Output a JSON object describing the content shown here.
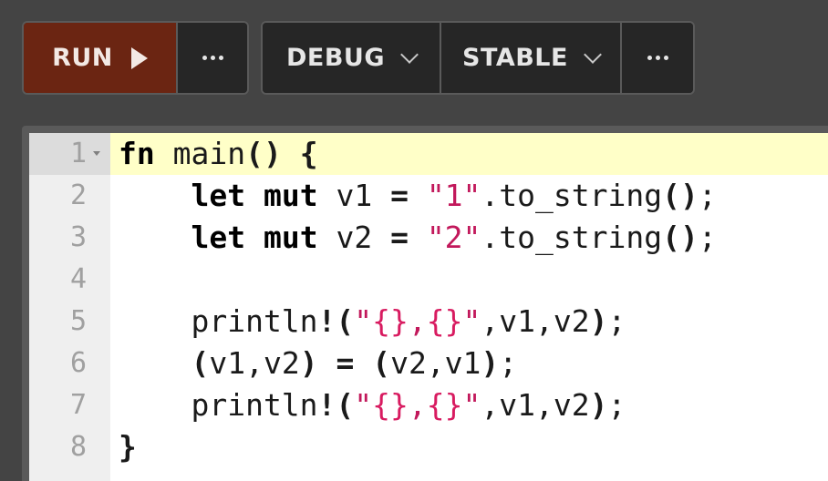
{
  "toolbar": {
    "run_label": "RUN",
    "run_icon": "play-icon",
    "more_icon": "ellipsis-icon",
    "debug_label": "DEBUG",
    "stable_label": "STABLE",
    "dropdown_icon": "chevron-down-icon",
    "colors": {
      "run_bg": "#6b2512",
      "button_bg": "#262626",
      "page_bg": "#444444"
    }
  },
  "editor": {
    "active_line": 1,
    "active_line_color": "#ffffc8",
    "lines": [
      {
        "number": "1",
        "text": "fn main() {"
      },
      {
        "number": "2",
        "text": "    let mut v1 = \"1\".to_string();"
      },
      {
        "number": "3",
        "text": "    let mut v2 = \"2\".to_string();"
      },
      {
        "number": "4",
        "text": ""
      },
      {
        "number": "5",
        "text": "    println!(\"{},{}\",v1,v2);"
      },
      {
        "number": "6",
        "text": "    (v1,v2) = (v2,v1);"
      },
      {
        "number": "7",
        "text": "    println!(\"{},{}\",v1,v2);"
      },
      {
        "number": "8",
        "text": "}"
      }
    ]
  }
}
